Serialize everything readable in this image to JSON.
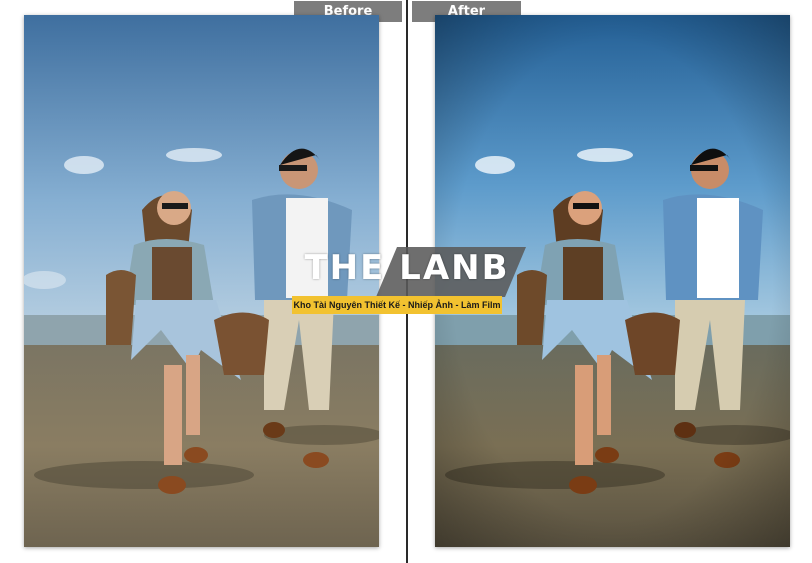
{
  "labels": {
    "before": "Before",
    "after": "After"
  },
  "watermark": {
    "title": "THE LANB",
    "subtitle": "Kho Tài Nguyên Thiết Kế - Nhiếp Ảnh - Làm Film"
  },
  "colors": {
    "tab_background": "#7d7d7d",
    "watermark_accent": "#f2c230",
    "divider": "#2a2a2a"
  }
}
